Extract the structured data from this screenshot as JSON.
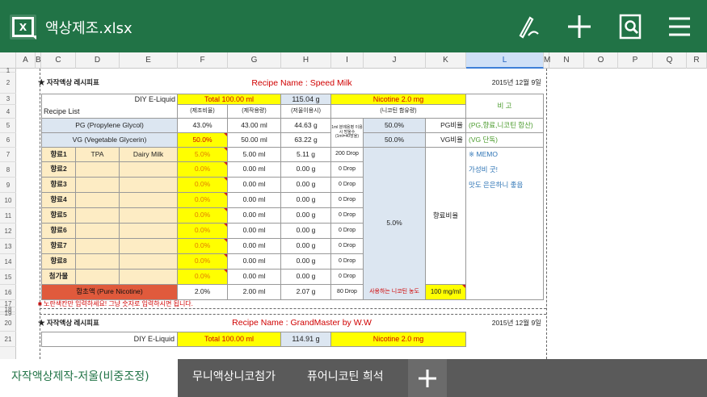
{
  "app": {
    "title": "액상제조.xlsx"
  },
  "columns": [
    "A",
    "B",
    "C",
    "D",
    "E",
    "F",
    "G",
    "H",
    "I",
    "J",
    "K",
    "L",
    "M",
    "N",
    "O",
    "P",
    "Q",
    "R"
  ],
  "rows": [
    "1",
    "2",
    "3",
    "4",
    "5",
    "6",
    "7",
    "8",
    "9",
    "10",
    "11",
    "12",
    "13",
    "14",
    "15",
    "16",
    "17",
    "18",
    "19",
    "20",
    "21"
  ],
  "sheet": {
    "header_left": "★ 자작액상 레시피표",
    "recipe_name": "Recipe Name : Speed Milk",
    "date": "2015년 12월 9일",
    "diy_label": "DIY E-Liquid",
    "recipe_list_label": "Recipe List",
    "total": "Total 100.00 ml",
    "total_weight": "115.04 g",
    "nicotine": "Nicotine 2.0 mg",
    "remarks_header": "비 고",
    "sub_headers": [
      "(제조비율)",
      "(제작용량)",
      "(저울이용시)",
      "(니코틴 함유량)"
    ],
    "pg_label": "PG (Propylene Glycol)",
    "pg_ratio": "43.0%",
    "pg_vol": "43.00 ml",
    "pg_weight": "44.63 g",
    "drop_note": "1ml 분례용병 이용시 방울수 (1ml=40방울)",
    "pg_pct": "50.0%",
    "pg_ratio_label": "PG비율",
    "pg_memo": "(PG,향료,니코틴 합산)",
    "vg_label": "VG (Vegetable Glycerin)",
    "vg_ratio": "50.0%",
    "vg_vol": "50.00 ml",
    "vg_weight": "63.22 g",
    "vg_pct": "50.0%",
    "vg_ratio_label": "VG비율",
    "vg_memo": "(VG 단독)",
    "flavors": [
      {
        "name": "향료1",
        "brand": "TPA",
        "flavor": "Dairy Milk",
        "ratio": "5.0%",
        "vol": "5.00 ml",
        "weight": "5.11 g",
        "drop": "200 Drop",
        "memo": "※ MEMO"
      },
      {
        "name": "향료2",
        "brand": "",
        "flavor": "",
        "ratio": "0.0%",
        "vol": "0.00 ml",
        "weight": "0.00 g",
        "drop": "0 Drop",
        "memo": "가성비 굿!"
      },
      {
        "name": "향료3",
        "brand": "",
        "flavor": "",
        "ratio": "0.0%",
        "vol": "0.00 ml",
        "weight": "0.00 g",
        "drop": "0 Drop",
        "memo": "맛도 은은하니 좋음"
      },
      {
        "name": "향료4",
        "brand": "",
        "flavor": "",
        "ratio": "0.0%",
        "vol": "0.00 ml",
        "weight": "0.00 g",
        "drop": "0 Drop",
        "memo": ""
      },
      {
        "name": "향료5",
        "brand": "",
        "flavor": "",
        "ratio": "0.0%",
        "vol": "0.00 ml",
        "weight": "0.00 g",
        "drop": "0 Drop",
        "memo": ""
      },
      {
        "name": "향료6",
        "brand": "",
        "flavor": "",
        "ratio": "0.0%",
        "vol": "0.00 ml",
        "weight": "0.00 g",
        "drop": "0 Drop",
        "memo": ""
      },
      {
        "name": "향료7",
        "brand": "",
        "flavor": "",
        "ratio": "0.0%",
        "vol": "0.00 ml",
        "weight": "0.00 g",
        "drop": "0 Drop",
        "memo": ""
      },
      {
        "name": "향료8",
        "brand": "",
        "flavor": "",
        "ratio": "0.0%",
        "vol": "0.00 ml",
        "weight": "0.00 g",
        "drop": "0 Drop",
        "memo": ""
      },
      {
        "name": "첨가물",
        "brand": "",
        "flavor": "",
        "ratio": "0.0%",
        "vol": "0.00 ml",
        "weight": "0.00 g",
        "drop": "0 Drop",
        "memo": ""
      }
    ],
    "flavor_pct": "5.0%",
    "flavor_ratio_label": "향료비율",
    "nic_label": "함초액 (Pure Nicotine)",
    "nic_ratio": "2.0%",
    "nic_vol": "2.00 ml",
    "nic_weight": "2.07 g",
    "nic_drop": "80 Drop",
    "nic_strength_label": "사용하는 니코틴 농도",
    "nic_strength": "100 mg/ml",
    "note": "■ 노란색칸만 입력하세요! 그냥 숫자로 입력하시면 됩니다.",
    "header_left_2": "★ 자작액상 레시피표",
    "recipe_name_2": "Recipe Name : GrandMaster by W.W",
    "date_2": "2015년 12월 9일",
    "diy_label_2": "DIY E-Liquid",
    "total_2": "Total 100.00 ml",
    "total_weight_2": "114.91 g",
    "nicotine_2": "Nicotine 2.0 mg"
  },
  "tabs": [
    "자작액상제작-저울(비중조정)",
    "무니액상니코첨가",
    "퓨어니코틴 희석"
  ],
  "colors": {
    "brand": "#217346",
    "yellow": "#ffff00",
    "tab_bar": "#5a5a5a"
  }
}
